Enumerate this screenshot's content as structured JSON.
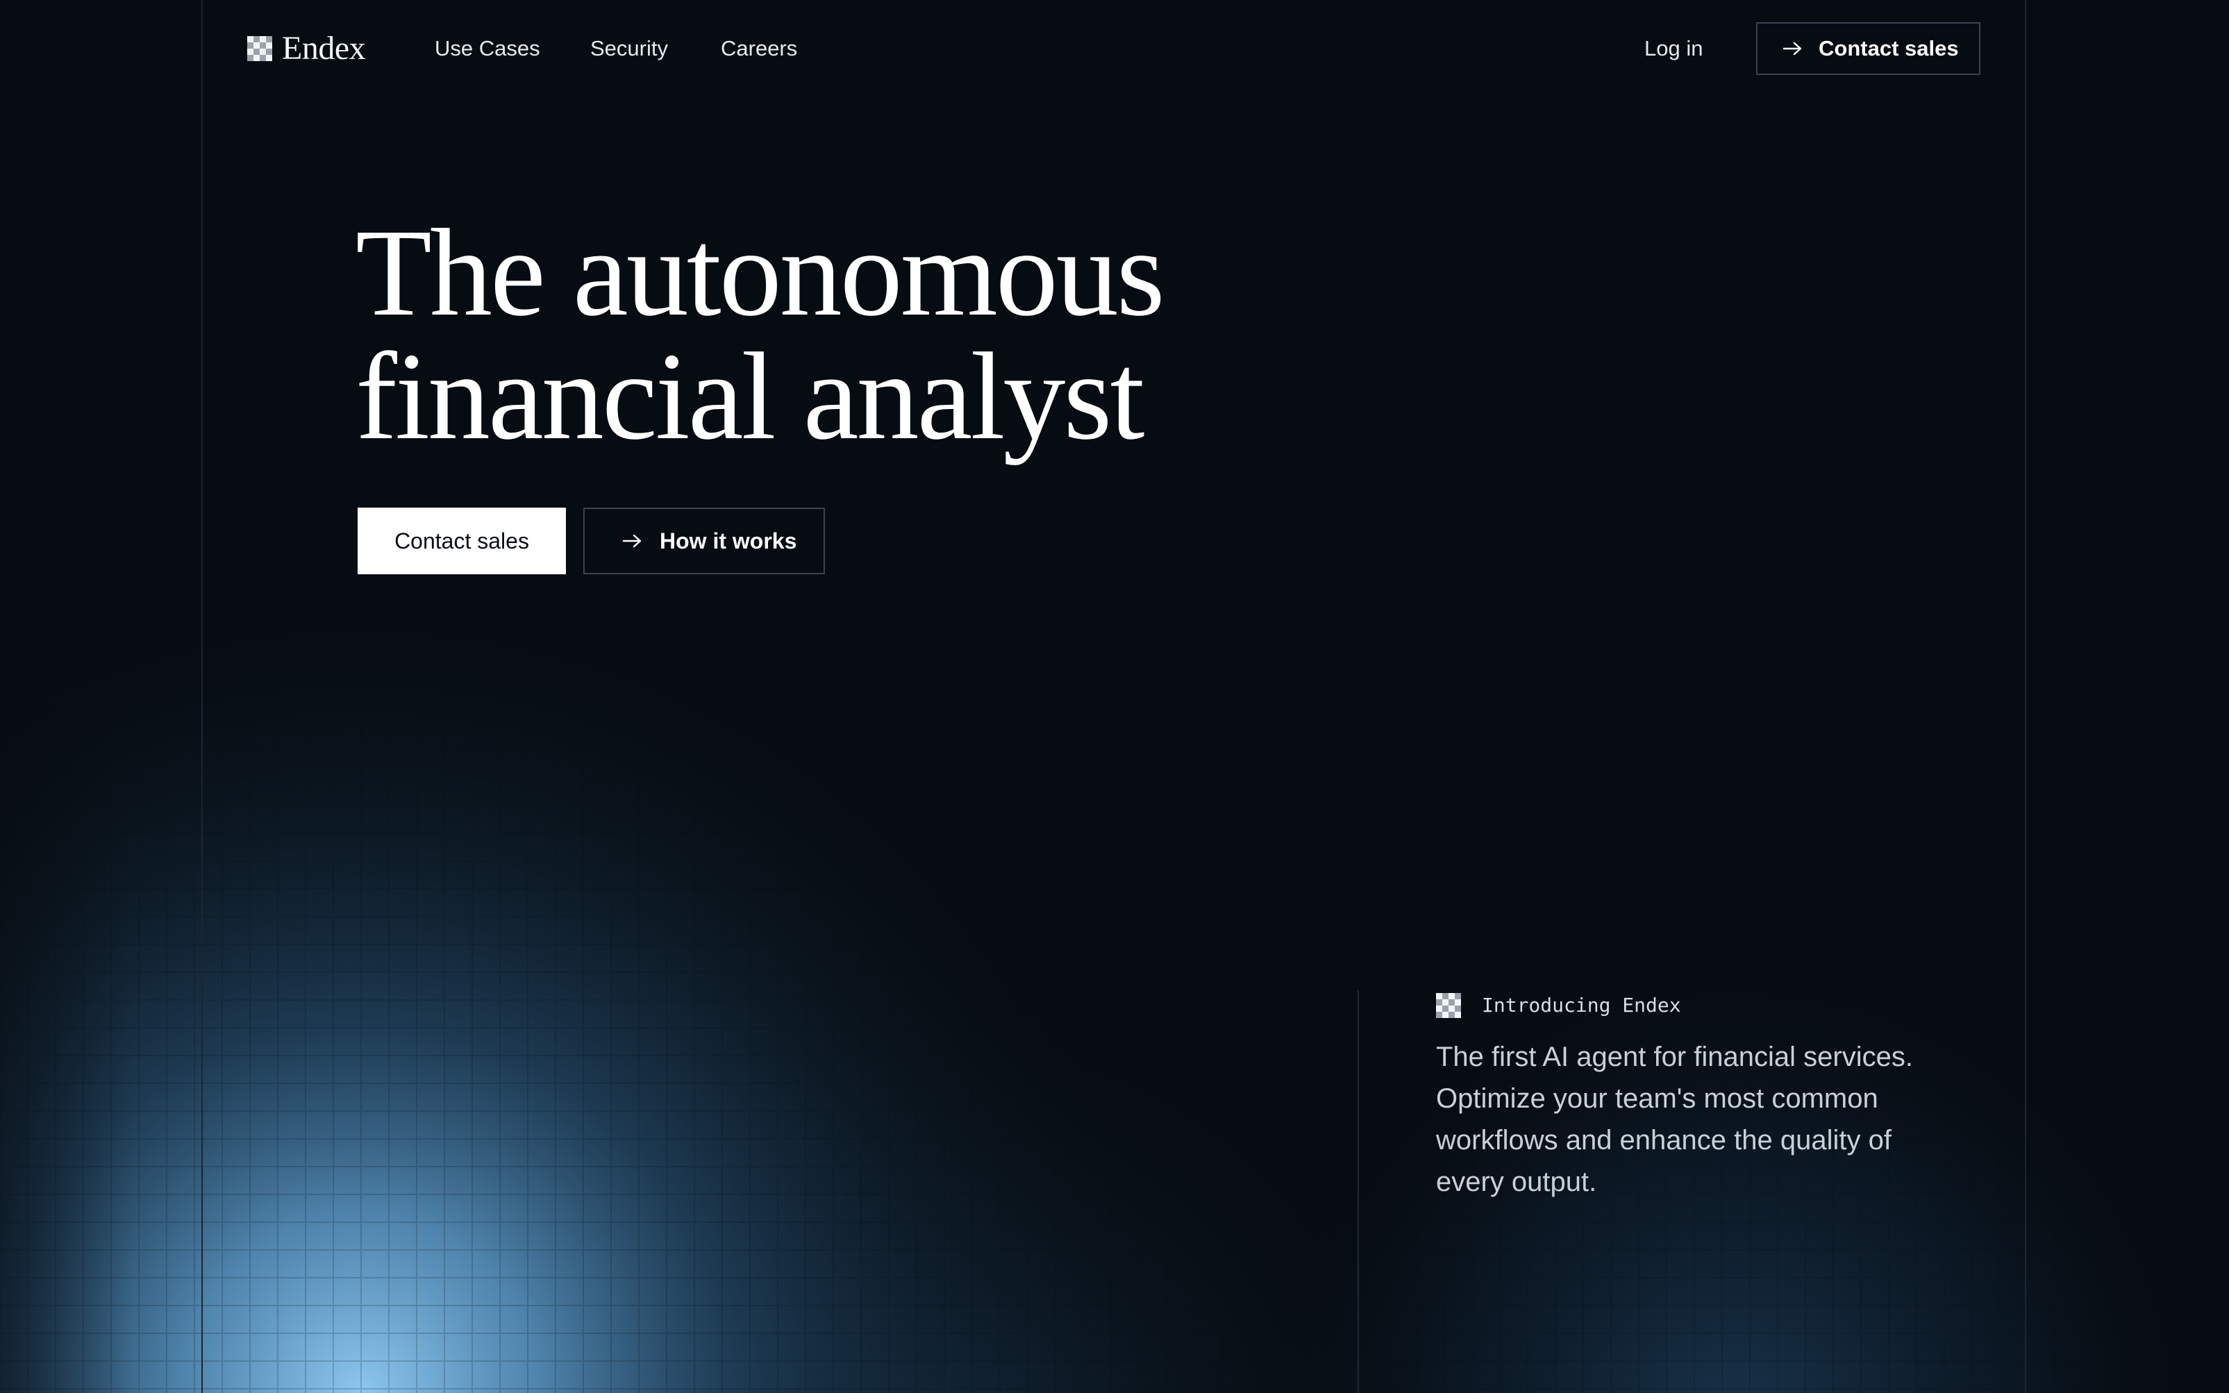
{
  "brand": {
    "name": "Endex",
    "logo_icon": "checker-logo-icon"
  },
  "nav": {
    "links": [
      "Use Cases",
      "Security",
      "Careers"
    ],
    "login_label": "Log in",
    "contact_label": "Contact sales"
  },
  "hero": {
    "title_line1": "The autonomous",
    "title_line2": "financial analyst",
    "primary_cta": "Contact sales",
    "secondary_cta": "How it works"
  },
  "intro": {
    "label": "Introducing Endex",
    "body": "The first AI agent for financial services. Optimize your team's most common workflows and enhance the quality of every output."
  },
  "colors": {
    "background": "#070c12",
    "text": "#ffffff",
    "glow": "#8cc7f0",
    "outline": "#3a4450"
  }
}
